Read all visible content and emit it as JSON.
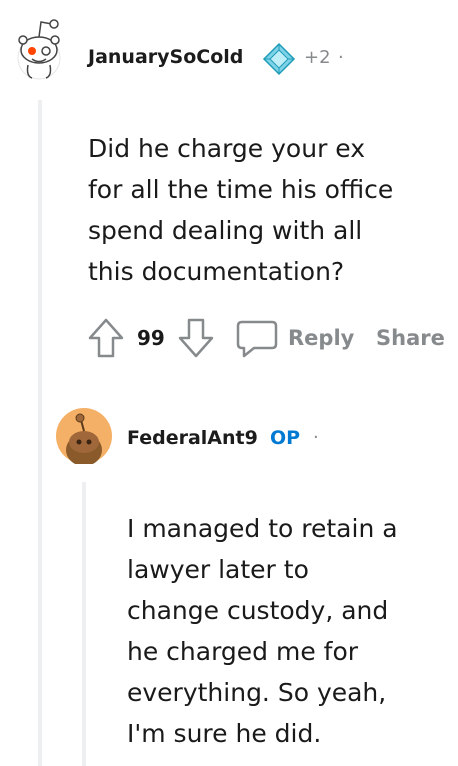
{
  "comments": [
    {
      "username": "JanuarySoCold",
      "award_count": "+2",
      "separator": "·",
      "body": "Did he charge your ex\nfor all the time his office\nspend dealing with all\nthis documentation?",
      "score": "99",
      "actions": {
        "reply": "Reply",
        "share": "Share"
      }
    },
    {
      "username": "FederalAnt9",
      "op_badge": "OP",
      "separator": "·",
      "body": "I managed to retain a\nlawyer later to\nchange custody, and\nhe charged me for\neverything. So yeah,\nI'm sure he did."
    }
  ],
  "icons": {
    "avatar_1": "snoo-avatar-icon",
    "award": "diamond-award-icon",
    "upvote": "upvote-arrow-icon",
    "downvote": "downvote-arrow-icon",
    "reply": "speech-bubble-icon",
    "avatar_2": "snoo-avatar-icon"
  },
  "colors": {
    "op": "#0079d3",
    "meta": "#878a8c",
    "avatar_2_bg": "#f4b066",
    "snoo_red": "#ff4500"
  }
}
